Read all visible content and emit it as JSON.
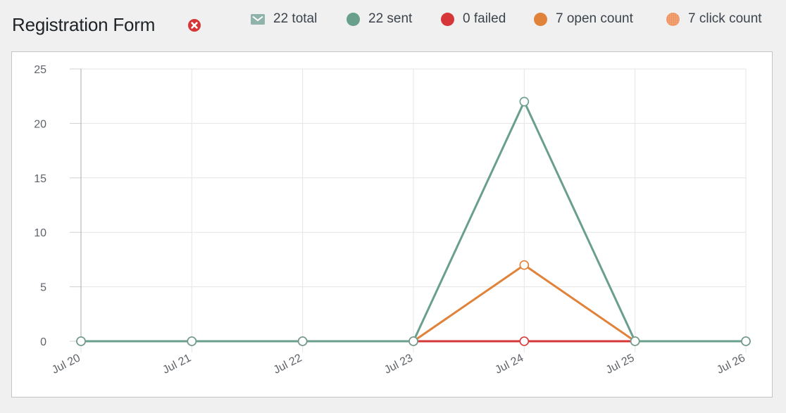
{
  "header": {
    "title": "Registration Form",
    "close_icon": "x-circle-icon"
  },
  "legend": [
    {
      "key": "total",
      "label": "22 total",
      "icon": "envelope-icon",
      "color": "#8fb3ab"
    },
    {
      "key": "sent",
      "label": "22 sent",
      "icon": "circle",
      "color": "#68a08b"
    },
    {
      "key": "failed",
      "label": "0 failed",
      "icon": "circle",
      "color": "#d63638"
    },
    {
      "key": "open",
      "label": "7 open count",
      "icon": "circle",
      "color": "#e0823a"
    },
    {
      "key": "click",
      "label": "7 click count",
      "icon": "dotted-circle",
      "color": "#f4a77a"
    }
  ],
  "chart_data": {
    "type": "line",
    "title": "Registration Form",
    "xlabel": "",
    "ylabel": "",
    "categories": [
      "Jul 20",
      "Jul 21",
      "Jul 22",
      "Jul 23",
      "Jul 24",
      "Jul 25",
      "Jul 26"
    ],
    "ylim": [
      0,
      25
    ],
    "yticks": [
      0,
      5,
      10,
      15,
      20,
      25
    ],
    "grid": true,
    "legend_position": "top-right",
    "series": [
      {
        "name": "failed",
        "color": "#d63638",
        "values": [
          0,
          0,
          0,
          0,
          0,
          0,
          0
        ]
      },
      {
        "name": "open count",
        "color": "#e0823a",
        "values": [
          0,
          0,
          0,
          0,
          7,
          0,
          0
        ]
      },
      {
        "name": "sent",
        "color": "#6a9e8e",
        "values": [
          0,
          0,
          0,
          0,
          22,
          0,
          0
        ]
      }
    ]
  }
}
